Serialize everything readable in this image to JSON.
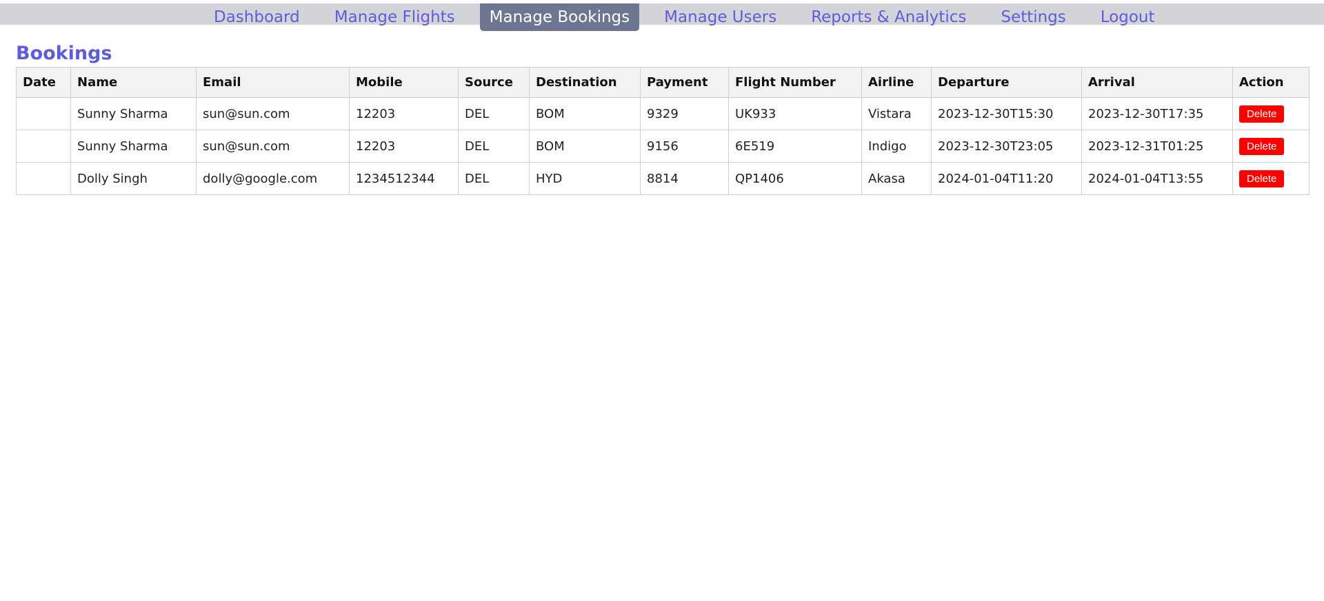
{
  "nav": {
    "items": [
      {
        "label": "Dashboard",
        "active": false
      },
      {
        "label": "Manage Flights",
        "active": false
      },
      {
        "label": "Manage Bookings",
        "active": true
      },
      {
        "label": "Manage Users",
        "active": false
      },
      {
        "label": "Reports & Analytics",
        "active": false
      },
      {
        "label": "Settings",
        "active": false
      },
      {
        "label": "Logout",
        "active": false
      }
    ]
  },
  "page": {
    "title": "Bookings"
  },
  "table": {
    "headers": [
      "Date",
      "Name",
      "Email",
      "Mobile",
      "Source",
      "Destination",
      "Payment",
      "Flight Number",
      "Airline",
      "Departure",
      "Arrival",
      "Action"
    ],
    "rows": [
      [
        "",
        "Sunny Sharma",
        "sun@sun.com",
        "12203",
        "DEL",
        "BOM",
        "9329",
        "UK933",
        "Vistara",
        "2023-12-30T15:30",
        "2023-12-30T17:35"
      ],
      [
        "",
        "Sunny Sharma",
        "sun@sun.com",
        "12203",
        "DEL",
        "BOM",
        "9156",
        "6E519",
        "Indigo",
        "2023-12-30T23:05",
        "2023-12-31T01:25"
      ],
      [
        "",
        "Dolly Singh",
        "dolly@google.com",
        "1234512344",
        "DEL",
        "HYD",
        "8814",
        "QP1406",
        "Akasa",
        "2024-01-04T11:20",
        "2024-01-04T13:55"
      ]
    ],
    "action_label": "Delete"
  },
  "colors": {
    "accent": "#5d5ddb",
    "nav_bar": "#d3d4d9",
    "nav_active": "#6e7591",
    "delete": "#ff0000"
  }
}
